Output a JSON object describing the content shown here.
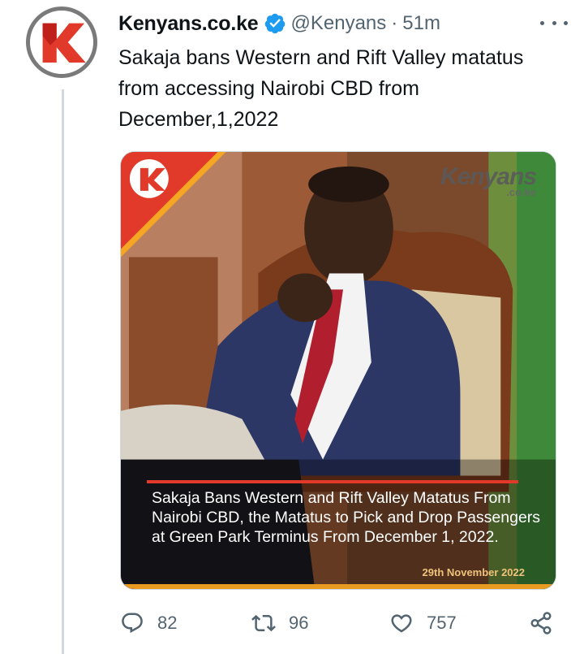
{
  "tweet": {
    "author_name": "Kenyans.co.ke",
    "handle": "@Kenyans",
    "separator": "·",
    "time": "51m",
    "text": "Sakaja bans Western and Rift Valley matatus from accessing Nairobi CBD from December,1,2022"
  },
  "media": {
    "watermark": "Kenyans",
    "watermark_sub": ".co.ke",
    "caption": "Sakaja Bans Western and Rift Valley Matatus From Nairobi CBD, the Matatus to Pick and Drop Passengers at Green Park Terminus From December 1, 2022.",
    "date": "29th November 2022"
  },
  "actions": {
    "replies": "82",
    "retweets": "96",
    "likes": "757"
  },
  "colors": {
    "brand_red": "#e23a2a",
    "verified_blue": "#1d9bf0",
    "muted_text": "#536471"
  },
  "icons": [
    "more-icon",
    "verified-icon",
    "reply-icon",
    "retweet-icon",
    "like-icon",
    "share-icon"
  ]
}
